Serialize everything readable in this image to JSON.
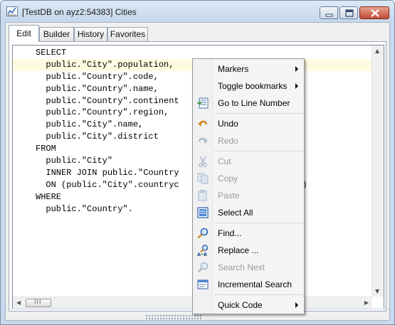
{
  "window": {
    "title": "[TestDB on ayz2:54383] Cities"
  },
  "tabs": [
    {
      "label": "Edit",
      "active": true
    },
    {
      "label": "Builder",
      "active": false
    },
    {
      "label": "History",
      "active": false
    },
    {
      "label": "Favorites",
      "active": false
    }
  ],
  "editor": {
    "lines": [
      "SELECT",
      "  public.\"City\".population,",
      "  public.\"Country\".code,",
      "  public.\"Country\".name,",
      "  public.\"Country\".continent",
      "  public.\"Country\".region,",
      "  public.\"City\".name,",
      "  public.\"City\".district",
      "FROM",
      "  public.\"City\"",
      "  INNER JOIN public.\"Country",
      "  ON (public.\"City\".countryc                ry\".code)",
      "WHERE",
      "  public.\"Country\"."
    ],
    "hscroll_thumb_grip": "III"
  },
  "context_menu": {
    "items": [
      {
        "label": "Markers",
        "icon": "none",
        "submenu": true,
        "enabled": true
      },
      {
        "label": "Toggle bookmarks",
        "icon": "none",
        "submenu": true,
        "enabled": true
      },
      {
        "label": "Go to Line Number",
        "icon": "goto-line-icon",
        "submenu": false,
        "enabled": true
      },
      {
        "label": "Undo",
        "icon": "undo-icon",
        "submenu": false,
        "enabled": true
      },
      {
        "label": "Redo",
        "icon": "redo-icon",
        "submenu": false,
        "enabled": false
      },
      {
        "label": "Cut",
        "icon": "cut-icon",
        "submenu": false,
        "enabled": false
      },
      {
        "label": "Copy",
        "icon": "copy-icon",
        "submenu": false,
        "enabled": false
      },
      {
        "label": "Paste",
        "icon": "paste-icon",
        "submenu": false,
        "enabled": false
      },
      {
        "label": "Select All",
        "icon": "select-all-icon",
        "submenu": false,
        "enabled": true
      },
      {
        "label": "Find...",
        "icon": "find-icon",
        "submenu": false,
        "enabled": true
      },
      {
        "label": "Replace ...",
        "icon": "replace-icon",
        "submenu": false,
        "enabled": true
      },
      {
        "label": "Search Next",
        "icon": "search-next-icon",
        "submenu": false,
        "enabled": false
      },
      {
        "label": "Incremental Search",
        "icon": "incremental-search-icon",
        "submenu": false,
        "enabled": true
      },
      {
        "label": "Quick Code",
        "icon": "none",
        "submenu": true,
        "enabled": true
      }
    ]
  },
  "colors": {
    "current_line": "#fffbe0",
    "disabled_text": "#9a9a9a",
    "titlebar": "#c9d9ec"
  }
}
